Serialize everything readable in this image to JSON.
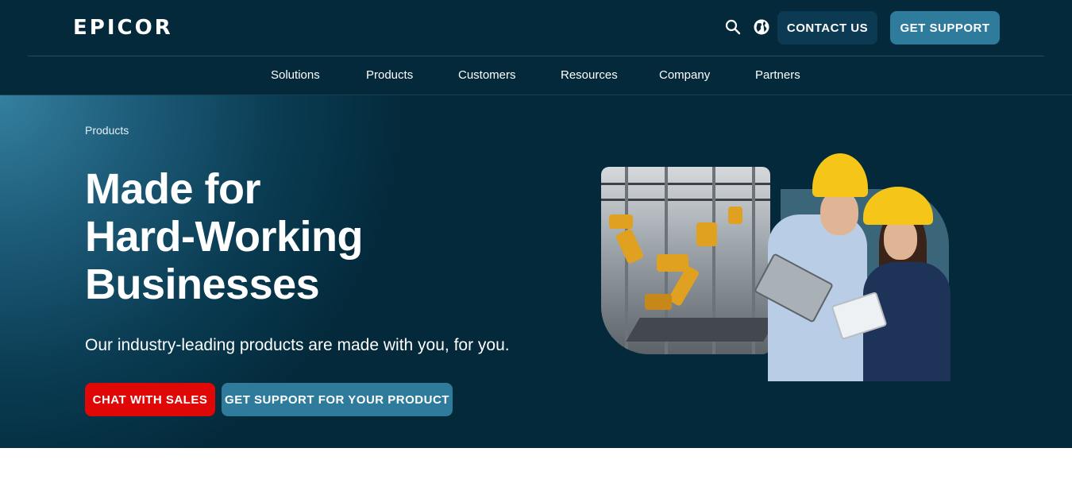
{
  "header": {
    "logo_text": "epicor",
    "search_icon": "search-icon",
    "globe_icon": "globe-icon",
    "contact_label": "CONTACT US",
    "support_label": "GET SUPPORT",
    "nav": [
      "Solutions",
      "Products",
      "Customers",
      "Resources",
      "Company",
      "Partners"
    ]
  },
  "hero": {
    "breadcrumb": "Products",
    "title_lines": [
      "Made for",
      "Hard-Working",
      "Businesses"
    ],
    "subtitle": "Our industry-leading products are made with you, for you.",
    "chat_label": "CHAT WITH SALES",
    "get_support_label": "GET SUPPORT FOR YOUR PRODUCT"
  },
  "colors": {
    "header_bg": "#03293a",
    "accent_teal": "#2e7b9c",
    "accent_red": "#e00707",
    "contact_bg": "#0b3a52"
  }
}
